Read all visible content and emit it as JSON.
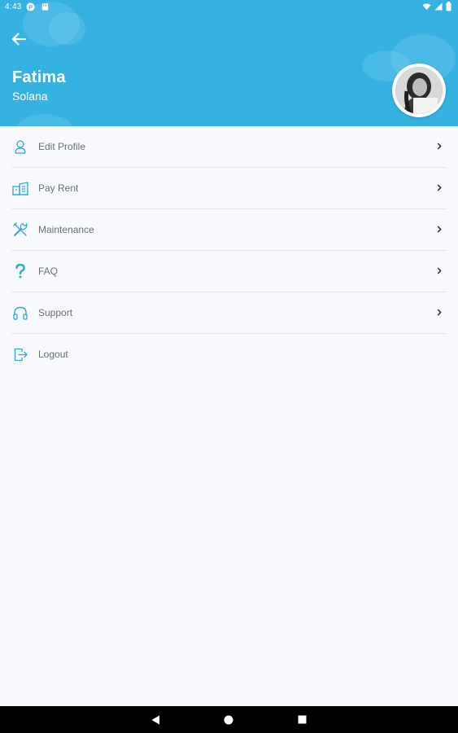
{
  "status_bar": {
    "time": "4:43"
  },
  "header": {
    "back_icon": "arrow-left-icon",
    "name": "Fatima",
    "subtitle": "Solana",
    "background": "#35b1e2"
  },
  "menu": {
    "items": [
      {
        "label": "Edit Profile",
        "icon": "user-icon",
        "has_chevron": true
      },
      {
        "label": "Pay Rent",
        "icon": "building-icon",
        "has_chevron": true
      },
      {
        "label": "Maintenance",
        "icon": "tools-icon",
        "has_chevron": true
      },
      {
        "label": "FAQ",
        "icon": "question-icon",
        "has_chevron": true
      },
      {
        "label": "Support",
        "icon": "headphones-icon",
        "has_chevron": true
      },
      {
        "label": "Logout",
        "icon": "logout-icon",
        "has_chevron": false
      }
    ]
  },
  "colors": {
    "accent": "#35b1e2",
    "icon": "#2aa8dc",
    "label": "#6b6f76",
    "background": "#f7f9fc"
  },
  "nav_bar": {
    "back_icon": "nav-back-icon",
    "home_icon": "nav-home-icon",
    "recents_icon": "nav-recents-icon"
  }
}
